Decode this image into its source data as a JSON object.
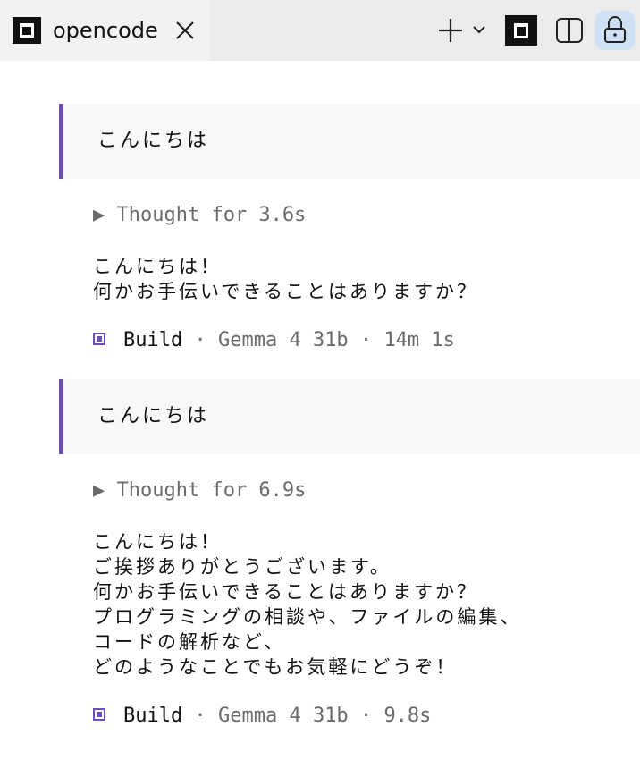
{
  "tab": {
    "title": "opencode",
    "app_icon": "opencode-logo-icon",
    "close_icon": "close-icon"
  },
  "toolbar": {
    "new_icon": "plus-icon",
    "dropdown_icon": "chevron-down-icon",
    "app_icon": "opencode-logo-icon",
    "split_icon": "split-view-icon",
    "lock_icon": "lock-icon"
  },
  "conversation": [
    {
      "user": "こんにちは",
      "thought": "▶ Thought for 3.6s",
      "reply": [
        "こんにちは！",
        "何かお手伝いできることはありますか？"
      ],
      "meta": {
        "agent": "Build",
        "model": "Gemma 4 31b",
        "duration": "14m 1s"
      }
    },
    {
      "user": "こんにちは",
      "thought": "▶ Thought for 6.9s",
      "reply": [
        "こんにちは！",
        "ご挨拶ありがとうございます。",
        "何かお手伝いできることはありますか？",
        "プログラミングの相談や、ファイルの編集、",
        "コードの解析など、",
        "どのようなことでもお気軽にどうぞ！"
      ],
      "meta": {
        "agent": "Build",
        "model": "Gemma 4 31b",
        "duration": "9.8s"
      }
    }
  ],
  "colors": {
    "accent": "#6b50b0",
    "tab_bg": "#f2f2f2",
    "lock_bg": "#cfe0f5"
  }
}
